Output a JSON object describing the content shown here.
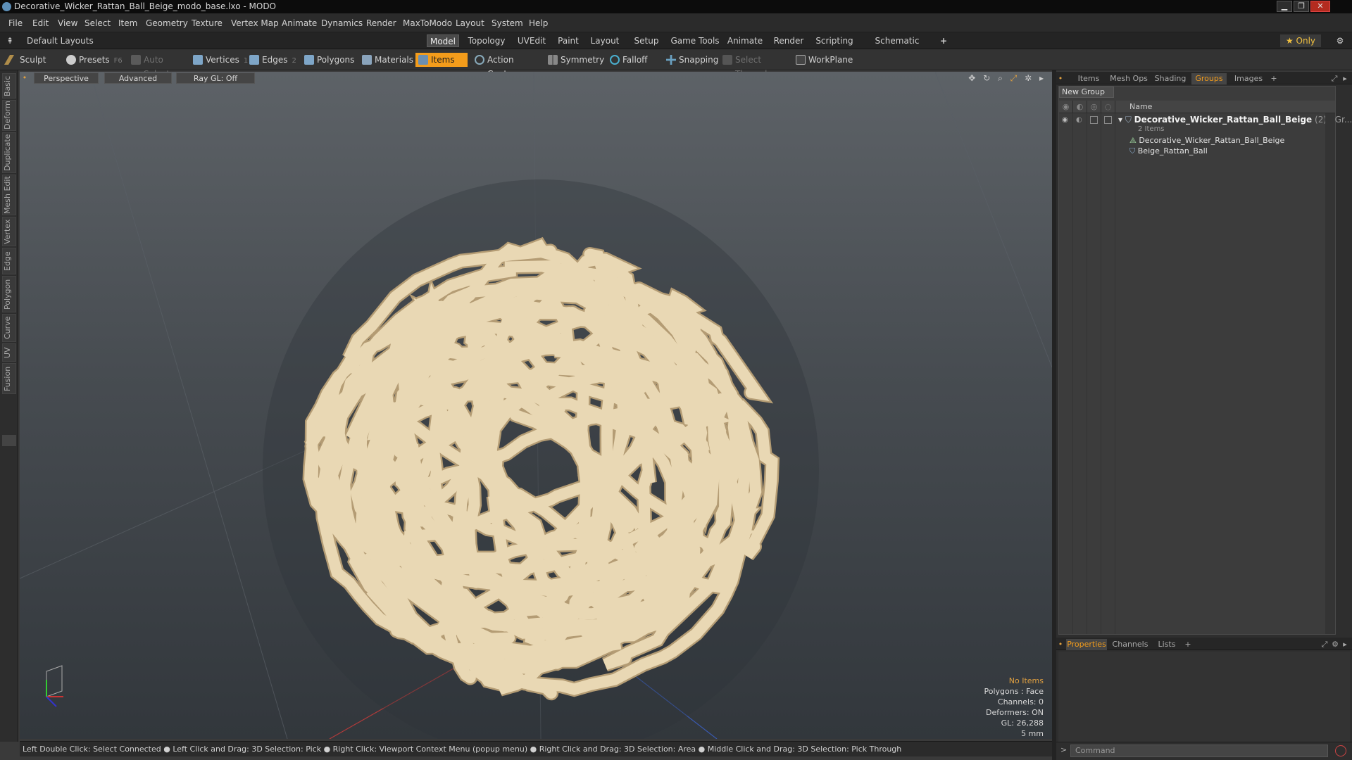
{
  "window": {
    "title": "Decorative_Wicker_Rattan_Ball_Beige_modo_base.lxo - MODO"
  },
  "menu": [
    "File",
    "Edit",
    "View",
    "Select",
    "Item",
    "Geometry",
    "Texture",
    "Vertex Map",
    "Animate",
    "Dynamics",
    "Render",
    "MaxToModo",
    "Layout",
    "System",
    "Help"
  ],
  "layout": {
    "preset": "Default Layouts ▾",
    "tabs": [
      "Model",
      "Topology",
      "UVEdit",
      "Paint",
      "Layout",
      "Setup",
      "Game Tools",
      "Animate",
      "Render",
      "Scripting",
      "Schematic Fusion"
    ],
    "active_tab": "Model",
    "add": "+",
    "only": "★ Only",
    "gear": "⚙"
  },
  "toolbar": {
    "sculpt": "Sculpt",
    "presets": "Presets",
    "presets_key": "F6",
    "auto_select": "Auto Select",
    "vertices": "Vertices",
    "vertices_count": "1",
    "edges": "Edges",
    "edges_count": "2",
    "polygons": "Polygons",
    "materials": "Materials",
    "items": "Items",
    "action_center": "Action Center",
    "symmetry": "Symmetry",
    "falloff": "Falloff",
    "snapping": "Snapping",
    "select_through": "Select Through",
    "workplane": "WorkPlane"
  },
  "left_tabs": [
    "Basic",
    "Deform",
    "Duplicate",
    "Mesh Edit",
    "Vertex",
    "Edge",
    "Polygon",
    "Curve",
    "UV",
    "Fusion"
  ],
  "viewport": {
    "view": "Perspective",
    "shading": "Advanced",
    "raygl": "Ray GL: Off",
    "hud": {
      "selection": "No Items",
      "polygons": "Polygons : Face",
      "channels": "Channels: 0",
      "deformers": "Deformers: ON",
      "gl": "GL: 26,288",
      "scale": "5 mm"
    }
  },
  "status": "Left Double Click: Select Connected ● Left Click and Drag: 3D Selection: Pick ● Right Click: Viewport Context Menu (popup menu) ● Right Click and Drag: 3D Selection: Area ● Middle Click and Drag: 3D Selection: Pick Through",
  "right_panel": {
    "tabs": [
      "Items",
      "Mesh Ops",
      "Shading",
      "Groups",
      "Images"
    ],
    "active_tab": "Groups",
    "new_group": "New Group",
    "name_header": "Name",
    "group_name": "Decorative_Wicker_Rattan_Ball_Beige",
    "group_suffix": "(2) : Gr...",
    "group_count": "2 Items",
    "children": [
      "Decorative_Wicker_Rattan_Ball_Beige",
      "Beige_Rattan_Ball"
    ],
    "bottom_tabs": [
      "Properties",
      "Channels",
      "Lists"
    ],
    "bottom_active": "Properties",
    "command_placeholder": "Command"
  }
}
